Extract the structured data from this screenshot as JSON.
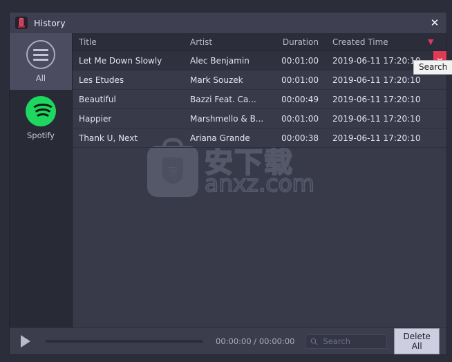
{
  "window": {
    "title": "History",
    "app_icon": "microphone-icon",
    "close_label": "✕"
  },
  "sidebar": {
    "items": [
      {
        "label": "All",
        "icon": "hamburger-icon",
        "selected": true
      },
      {
        "label": "Spotify",
        "icon": "spotify-icon",
        "selected": false
      }
    ]
  },
  "table": {
    "columns": [
      "Title",
      "Artist",
      "Duration",
      "Created Time"
    ],
    "sort": {
      "column": "Created Time",
      "direction": "descending",
      "glyph": "▼"
    },
    "row_action_icons": [
      "search-icon",
      "delete-icon"
    ],
    "rows": [
      {
        "title": "Let Me Down Slowly",
        "artist": "Alec Benjamin",
        "duration": "00:01:00",
        "created": "2019-06-11 17:20:10",
        "hovered": true
      },
      {
        "title": "Les Etudes",
        "artist": "Mark Souzek",
        "duration": "00:01:00",
        "created": "2019-06-11 17:20:10",
        "hovered": false
      },
      {
        "title": "Beautiful",
        "artist": "Bazzi Feat. Ca...",
        "duration": "00:00:49",
        "created": "2019-06-11 17:20:10",
        "hovered": false
      },
      {
        "title": "Happier",
        "artist": "Marshmello & B...",
        "duration": "00:01:00",
        "created": "2019-06-11 17:20:10",
        "hovered": false
      },
      {
        "title": "Thank U, Next",
        "artist": "Ariana Grande",
        "duration": "00:00:38",
        "created": "2019-06-11 17:20:10",
        "hovered": false
      }
    ]
  },
  "tooltip": {
    "text": "Search"
  },
  "watermark": {
    "chinese": "安下载",
    "english": "anxz.com",
    "badge_char": "安"
  },
  "player": {
    "play_icon": "play-icon",
    "progress_percent": 0,
    "time": "00:00:00 / 00:00:00"
  },
  "search": {
    "placeholder": "Search",
    "value": "",
    "icon": "search-icon"
  },
  "actions": {
    "delete_all_label": "Delete All"
  },
  "colors": {
    "accent_red": "#e03a55",
    "spotify_green": "#1ed760",
    "window_bg": "#383a4a",
    "sidebar_bg": "#282a36",
    "titlebar_bg": "#3e4052",
    "selected_bg": "#4b4c60"
  }
}
